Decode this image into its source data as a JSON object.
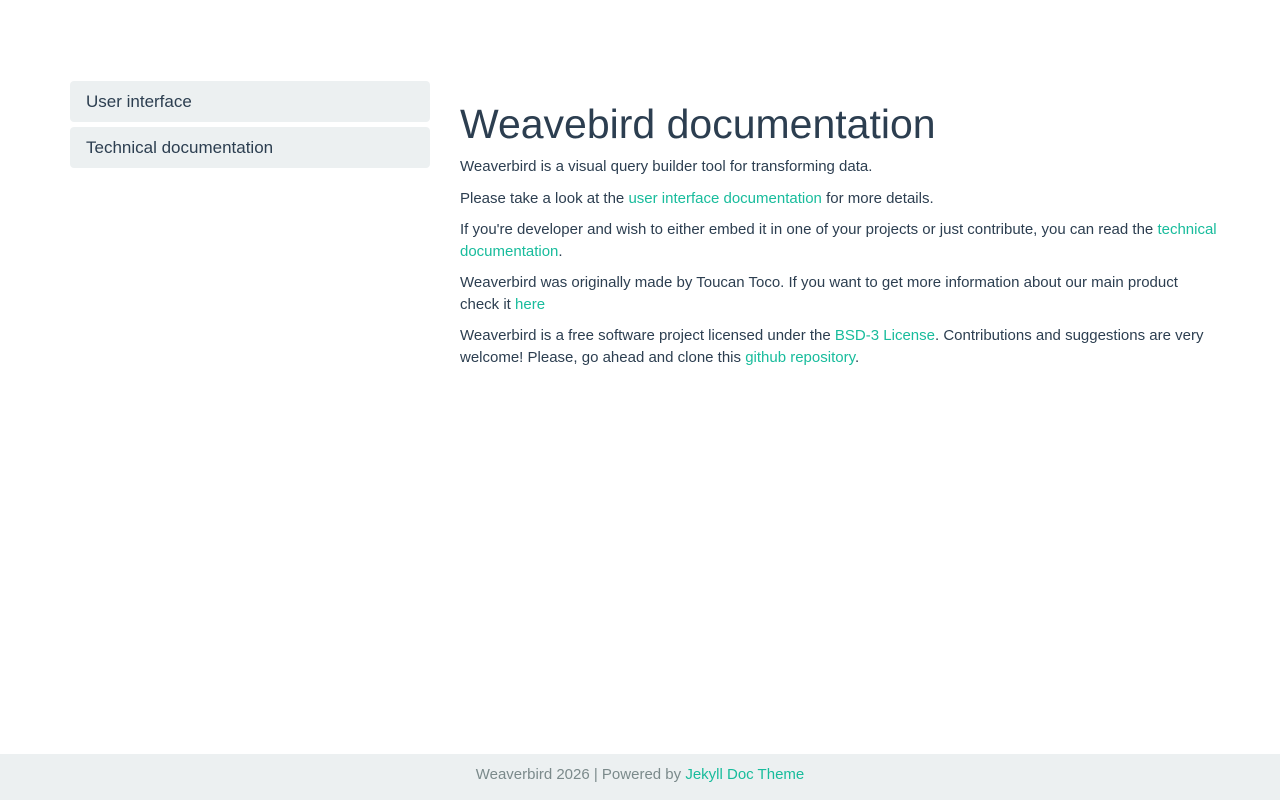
{
  "sidebar": {
    "items": [
      {
        "label": "User interface"
      },
      {
        "label": "Technical documentation"
      }
    ]
  },
  "main": {
    "title": "Weavebird documentation",
    "p1": "Weaverbird is a visual query builder tool for transforming data.",
    "p2": {
      "before": "Please take a look at the ",
      "link": "user interface documentation",
      "after": " for more details."
    },
    "p3": {
      "before": "If you're developer and wish to either embed it in one of your projects or just contribute, you can read the ",
      "link": "technical documentation",
      "after": "."
    },
    "p4": {
      "before": "Weaverbird was originally made by Toucan Toco. If you want to get more information about our main product check it ",
      "link": "here"
    },
    "p5": {
      "before": "Weaverbird is a free software project licensed under the ",
      "link1": "BSD-3 License",
      "middle": ". Contributions and suggestions are very welcome! Please, go ahead and clone this ",
      "link2": "github repository",
      "after": "."
    }
  },
  "footer": {
    "text": "Weaverbird 2026 | Powered by ",
    "link": "Jekyll Doc Theme"
  },
  "colors": {
    "text": "#2c3e50",
    "link": "#18bc9c",
    "sidebar_bg": "#ecf0f1",
    "footer_bg": "#ecf0f1",
    "footer_text": "#7b8a8b"
  }
}
